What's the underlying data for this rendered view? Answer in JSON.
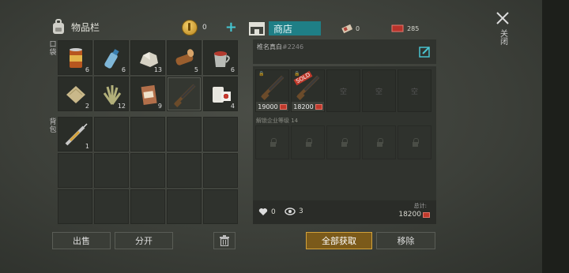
{
  "inventory": {
    "title": "物品栏",
    "coins": "0",
    "pocket_label": "口袋",
    "backpack_label": "背包",
    "pocket_items": [
      {
        "icon": "canned-food-icon",
        "count": "6"
      },
      {
        "icon": "water-bottle-icon",
        "count": "6"
      },
      {
        "icon": "stone-icon",
        "count": "13"
      },
      {
        "icon": "log-icon",
        "count": "5"
      },
      {
        "icon": "cup-icon",
        "count": "6"
      },
      {
        "icon": "cloth-icon",
        "count": "2"
      },
      {
        "icon": "plant-fiber-icon",
        "count": "12"
      },
      {
        "icon": "snack-bag-icon",
        "count": "9"
      },
      {
        "icon": "shotgun-icon",
        "count": ""
      },
      {
        "icon": "bandage-icon",
        "count": "4"
      }
    ],
    "backpack_items": [
      {
        "icon": "syringe-icon",
        "count": "1"
      }
    ]
  },
  "buttons": {
    "sell": "出售",
    "split": "分开",
    "collect_all": "全部获取",
    "remove": "移除",
    "close": "关闭"
  },
  "shop": {
    "title": "商店",
    "ticket_a": "0",
    "ticket_b": "285",
    "seller": "椎名真白",
    "seller_id": "#2246",
    "slots": [
      {
        "type": "item",
        "icon": "shotgun-icon",
        "price": "19000",
        "sold": false
      },
      {
        "type": "item",
        "icon": "shotgun-icon",
        "price": "18200",
        "sold": true,
        "sold_label": "SOLD"
      },
      {
        "type": "empty",
        "label": "空"
      },
      {
        "type": "empty",
        "label": "空"
      },
      {
        "type": "empty",
        "label": "空"
      }
    ],
    "unlock_text": "解锁企业等级 14",
    "likes": "0",
    "views": "3",
    "total_label": "总计:",
    "total_value": "18200"
  },
  "colors": {
    "accent": "#1f7f86",
    "gold_button": "#d2a23a",
    "plus": "#45c6d2"
  }
}
